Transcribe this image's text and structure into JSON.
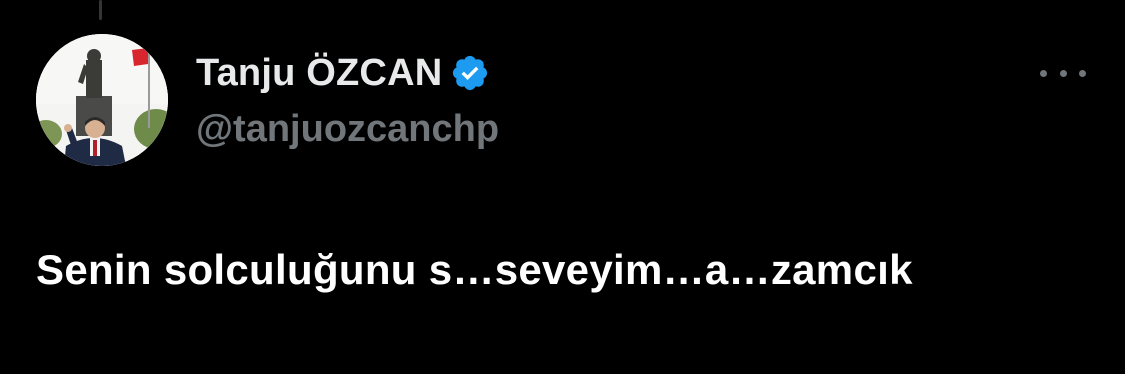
{
  "colors": {
    "background": "#000000",
    "text_primary": "#e7e9ea",
    "text_secondary": "#71767b",
    "verified_badge": "#1d9bf0"
  },
  "author": {
    "display_name": "Tanju ÖZCAN",
    "handle": "@tanjuozcanchp",
    "avatar_icon": "profile-photo",
    "verified_icon": "verified-badge-icon"
  },
  "menu": {
    "icon": "more-options-icon"
  },
  "tweet": {
    "text": "Senin solculuğunu s…seveyim…a…zamcık"
  }
}
